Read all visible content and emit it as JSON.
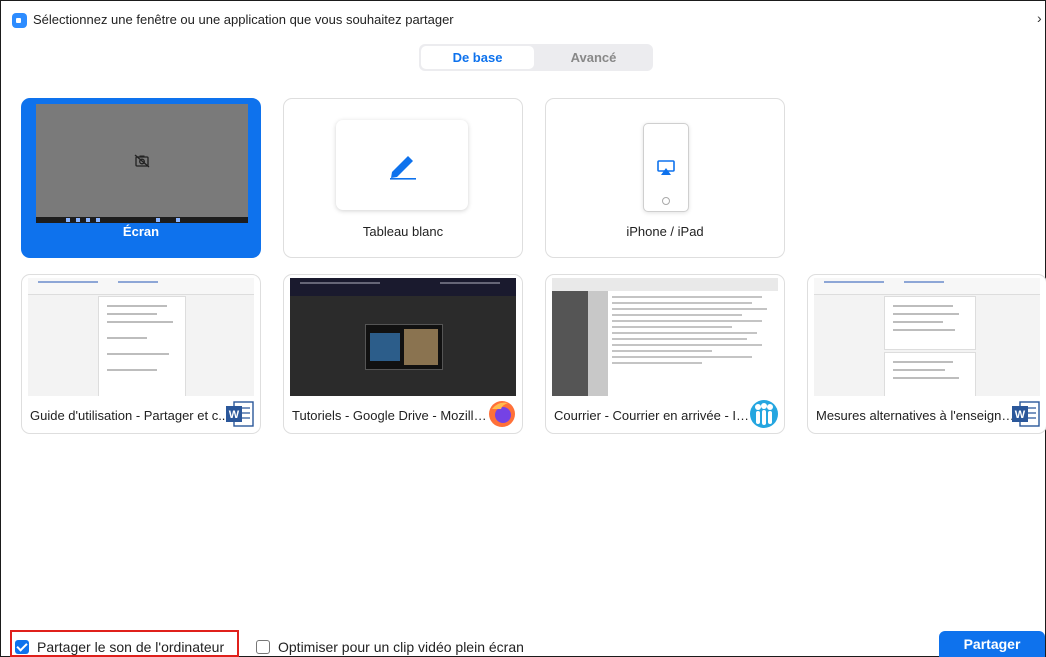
{
  "window": {
    "title": "Sélectionnez une fenêtre ou une application que vous souhaitez partager",
    "close_glyph": "›"
  },
  "tabs": {
    "basic": "De base",
    "advanced": "Avancé",
    "selected": "De base"
  },
  "tiles": {
    "screen": {
      "label": "Écran",
      "selected": true,
      "icon": "camera-off-icon"
    },
    "whiteboard": {
      "label": "Tableau blanc",
      "icon": "pencil-icon"
    },
    "iphone": {
      "label": "iPhone / iPad",
      "icon": "airplay-icon"
    }
  },
  "apps": [
    {
      "label": "Guide d'utilisation - Partager et c...",
      "icon": "word-icon"
    },
    {
      "label": "Tutoriels - Google Drive - Mozilla ...",
      "icon": "firefox-icon"
    },
    {
      "label": "Courrier - Courrier en arrivée - IB...",
      "icon": "lotus-notes-icon"
    },
    {
      "label": "Mesures alternatives à l'enseigne...",
      "icon": "word-icon"
    }
  ],
  "footer": {
    "share_audio": {
      "label": "Partager le son de l'ordinateur",
      "checked": true
    },
    "optimize_video": {
      "label": "Optimiser pour un clip vidéo plein écran",
      "checked": false
    },
    "share_button": "Partager"
  },
  "colors": {
    "accent": "#0e72ed",
    "highlight_box": "#e0201b"
  }
}
